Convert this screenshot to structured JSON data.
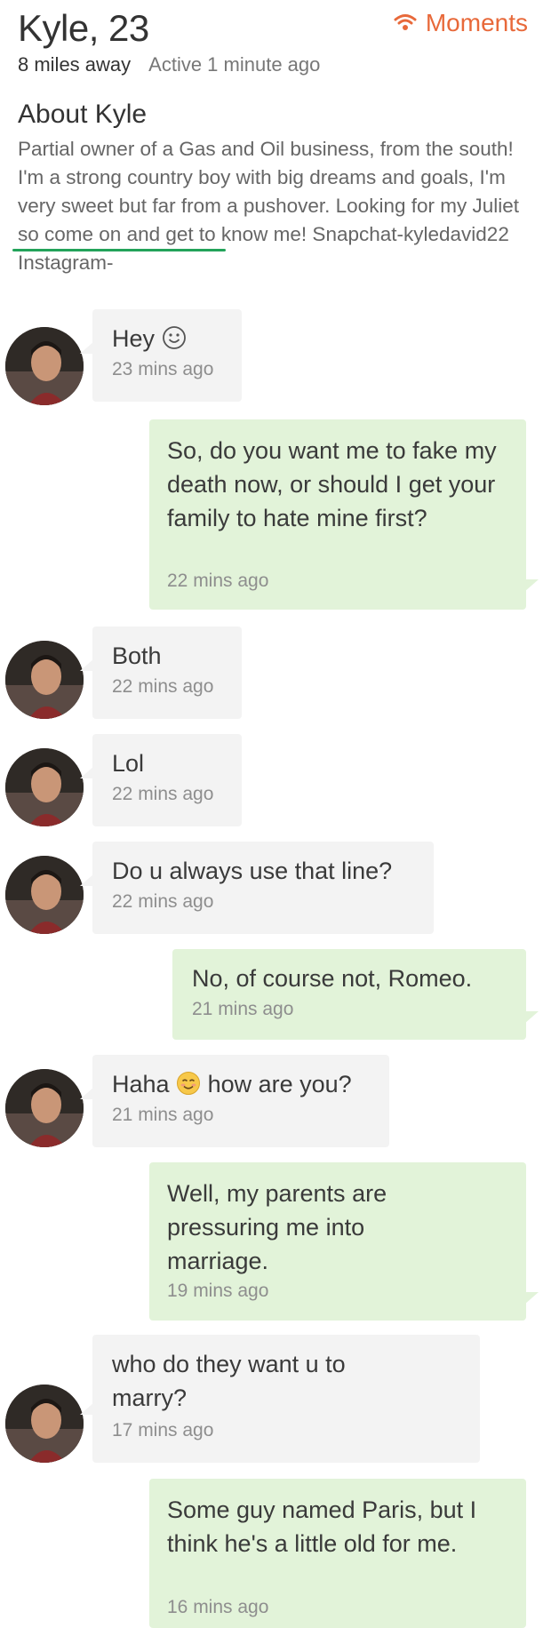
{
  "profile": {
    "name_age": "Kyle, 23",
    "moments_label": "Moments",
    "distance": "8 miles away",
    "active": "Active 1 minute ago",
    "about_title": "About Kyle",
    "bio": "Partial owner of a Gas and Oil business, from the south! I'm a strong country boy with big dreams and goals, I'm very sweet but far from a pushover. Looking for my Juliet so come on and get to know me! Snapchat-kyledavid22 Instagram-"
  },
  "colors": {
    "accent": "#e8693a",
    "incoming_bubble": "#f3f3f3",
    "outgoing_bubble": "#e2f3d9",
    "highlight_underline": "#23a35a"
  },
  "messages": [
    {
      "sender": "them",
      "text": "Hey",
      "emoji": "smile-emoji-icon",
      "time": "23 mins ago"
    },
    {
      "sender": "me",
      "text": "So, do you want me to fake my death now, or should I get your family to hate mine first?",
      "time": "22 mins ago"
    },
    {
      "sender": "them",
      "text": "Both",
      "time": "22 mins ago"
    },
    {
      "sender": "them",
      "text": "Lol",
      "time": "22 mins ago"
    },
    {
      "sender": "them",
      "text": "Do u always use that line?",
      "time": "22 mins ago"
    },
    {
      "sender": "me",
      "text": "No, of course not, Romeo.",
      "time": "21 mins ago"
    },
    {
      "sender": "them",
      "text": "Haha",
      "emoji": "blush-emoji-icon",
      "text_after": "how are you?",
      "time": "21 mins ago"
    },
    {
      "sender": "me",
      "text": "Well, my parents are pressuring me into marriage.",
      "time": "19 mins ago"
    },
    {
      "sender": "them",
      "text": "who do they want u to marry?",
      "time": "17 mins ago"
    },
    {
      "sender": "me",
      "text": "Some guy named Paris, but I think he's a little old for me.",
      "time": "16 mins ago"
    }
  ]
}
